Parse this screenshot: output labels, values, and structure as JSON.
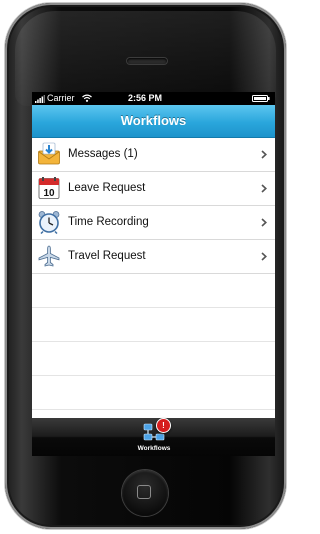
{
  "status_bar": {
    "carrier": "Carrier",
    "time": "2:56 PM"
  },
  "nav": {
    "title": "Workflows"
  },
  "list": {
    "items": [
      {
        "label": "Messages (1)",
        "icon": "messages-icon"
      },
      {
        "label": "Leave Request",
        "icon": "calendar-icon"
      },
      {
        "label": "Time Recording",
        "icon": "alarm-clock-icon"
      },
      {
        "label": "Travel Request",
        "icon": "airplane-icon"
      }
    ]
  },
  "tab_bar": {
    "items": [
      {
        "label": "Workflows",
        "icon": "workflow-icon",
        "badge": "!"
      }
    ]
  },
  "colors": {
    "nav_top": "#5cc6ef",
    "nav_bottom": "#1d93cb",
    "badge": "#d61d1d"
  }
}
